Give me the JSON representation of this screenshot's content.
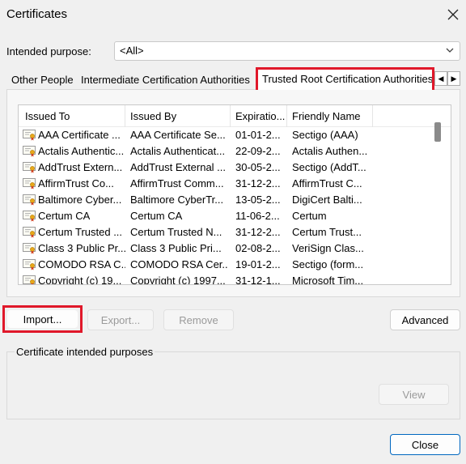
{
  "window": {
    "title": "Certificates"
  },
  "intended_purpose": {
    "label": "Intended purpose:",
    "value": "<All>"
  },
  "tabs": [
    {
      "label": "Other People"
    },
    {
      "label": "Intermediate Certification Authorities"
    },
    {
      "label": "Trusted Root Certification Authorities"
    }
  ],
  "table": {
    "headers": [
      "Issued To",
      "Issued By",
      "Expiratio...",
      "Friendly Name"
    ],
    "rows": [
      [
        "AAA Certificate ...",
        "AAA Certificate Se...",
        "01-01-2...",
        "Sectigo (AAA)"
      ],
      [
        "Actalis Authentic...",
        "Actalis Authenticat...",
        "22-09-2...",
        "Actalis Authen..."
      ],
      [
        "AddTrust Extern...",
        "AddTrust External ...",
        "30-05-2...",
        "Sectigo (AddT..."
      ],
      [
        "AffirmTrust Co...",
        "AffirmTrust Comm...",
        "31-12-2...",
        "AffirmTrust C..."
      ],
      [
        "Baltimore Cyber...",
        "Baltimore CyberTr...",
        "13-05-2...",
        "DigiCert Balti..."
      ],
      [
        "Certum CA",
        "Certum CA",
        "11-06-2...",
        "Certum"
      ],
      [
        "Certum Trusted ...",
        "Certum Trusted N...",
        "31-12-2...",
        "Certum Trust..."
      ],
      [
        "Class 3 Public Pr...",
        "Class 3 Public Pri...",
        "02-08-2...",
        "VeriSign Clas..."
      ],
      [
        "COMODO RSA C...",
        "COMODO RSA Cer...",
        "19-01-2...",
        "Sectigo (form..."
      ],
      [
        "Copyright (c) 19...",
        "Copyright (c) 1997...",
        "31-12-1...",
        "Microsoft Tim..."
      ]
    ]
  },
  "buttons": {
    "import": "Import...",
    "export": "Export...",
    "remove": "Remove",
    "advanced": "Advanced",
    "view": "View",
    "close": "Close"
  },
  "purposes_group": {
    "label": "Certificate intended purposes"
  },
  "icons": {
    "close": "close-icon",
    "dropdown": "chevron-down-icon",
    "tab_left": "arrow-left-icon",
    "tab_right": "arrow-right-icon",
    "certificate": "certificate-icon"
  },
  "colors": {
    "highlight": "#e0182a",
    "accent": "#0067c0"
  }
}
